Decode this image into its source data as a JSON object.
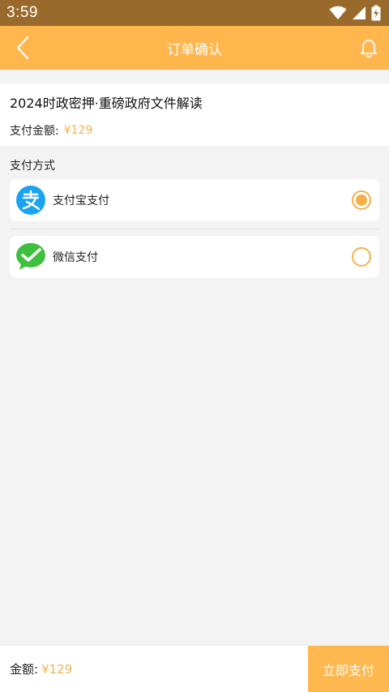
{
  "status_bar": {
    "time": "3:59",
    "icons": [
      "wifi-icon",
      "cellular-signal-icon",
      "battery-charging-icon"
    ]
  },
  "app_bar": {
    "title": "订单确认",
    "back_icon": "chevron-left-icon",
    "notification_icon": "bell-icon"
  },
  "order": {
    "product_name": "2024时政密押·重磅政府文件解读",
    "amount_label": "支付金额:",
    "amount": "¥129"
  },
  "payment": {
    "section_label": "支付方式",
    "options": [
      {
        "label": "支付宝支付",
        "icon": "alipay-logo-icon",
        "selected": true
      },
      {
        "label": "微信支付",
        "icon": "wechat-pay-logo-icon",
        "selected": false
      }
    ]
  },
  "bottom_bar": {
    "amount_label": "金额:",
    "amount": "¥129",
    "pay_button_label": "立即支付"
  },
  "colors": {
    "status_bar": "#9a6a2c",
    "accent": "#ffb64d",
    "price": "#f0b450",
    "alipay_blue": "#1aa3f0",
    "wechat_green": "#3ec03e"
  }
}
